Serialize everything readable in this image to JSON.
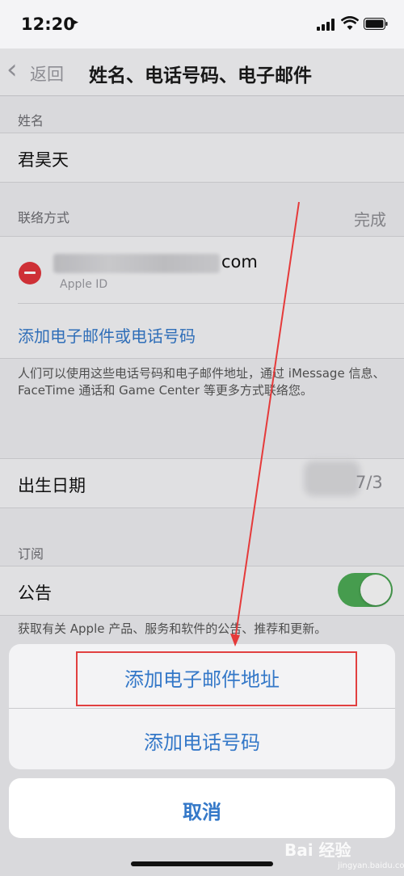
{
  "status_bar": {
    "time": "12:20"
  },
  "nav": {
    "back_label": "返回",
    "title": "姓名、电话号码、电子邮件"
  },
  "name_section": {
    "header": "姓名",
    "value": "君昊天"
  },
  "contact_section": {
    "header": "联络方式",
    "done": "完成",
    "email_suffix": "com",
    "email_sub": "Apple ID",
    "add_link": "添加电子邮件或电话号码",
    "footnote": "人们可以使用这些电话号码和电子邮件地址，通过 iMessage 信息、FaceTime 通话和 Game Center 等更多方式联络您。"
  },
  "birthday": {
    "label": "出生日期",
    "value": "7/3"
  },
  "subscribe_section": {
    "header": "订阅",
    "announcement_label": "公告",
    "announcement_on": true,
    "footnote": "获取有关 Apple 产品、服务和软件的公告、推荐和更新。"
  },
  "action_sheet": {
    "add_email": "添加电子邮件地址",
    "add_phone": "添加电话号码",
    "cancel": "取消"
  },
  "watermark": {
    "main": "Bai 经验",
    "sub": "jingyan.baidu.com"
  },
  "colors": {
    "link": "#3478c8",
    "toggle_on": "#4caa55",
    "delete": "#e0353b",
    "highlight": "#e14040"
  }
}
